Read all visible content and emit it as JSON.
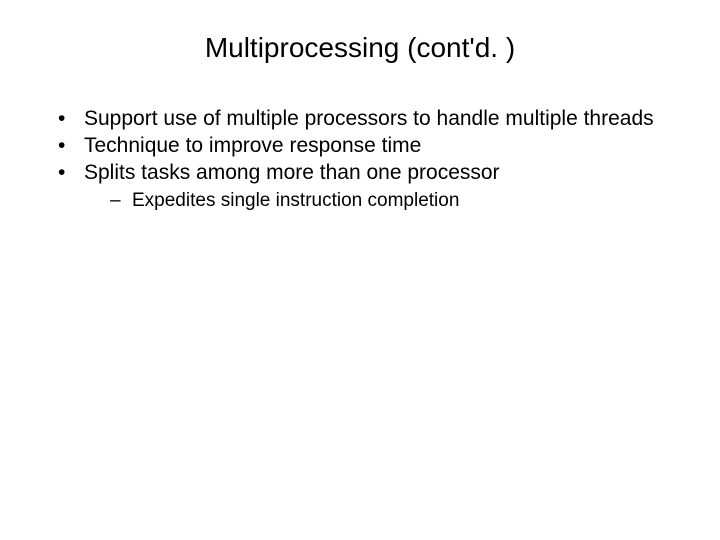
{
  "slide": {
    "title": "Multiprocessing (cont'd. )",
    "bullets": [
      {
        "text": "Support use of multiple processors to handle multiple threads"
      },
      {
        "text": "Technique to improve response time"
      },
      {
        "text": "Splits tasks among more than one processor",
        "sub": [
          "Expedites single instruction completion"
        ]
      }
    ]
  }
}
